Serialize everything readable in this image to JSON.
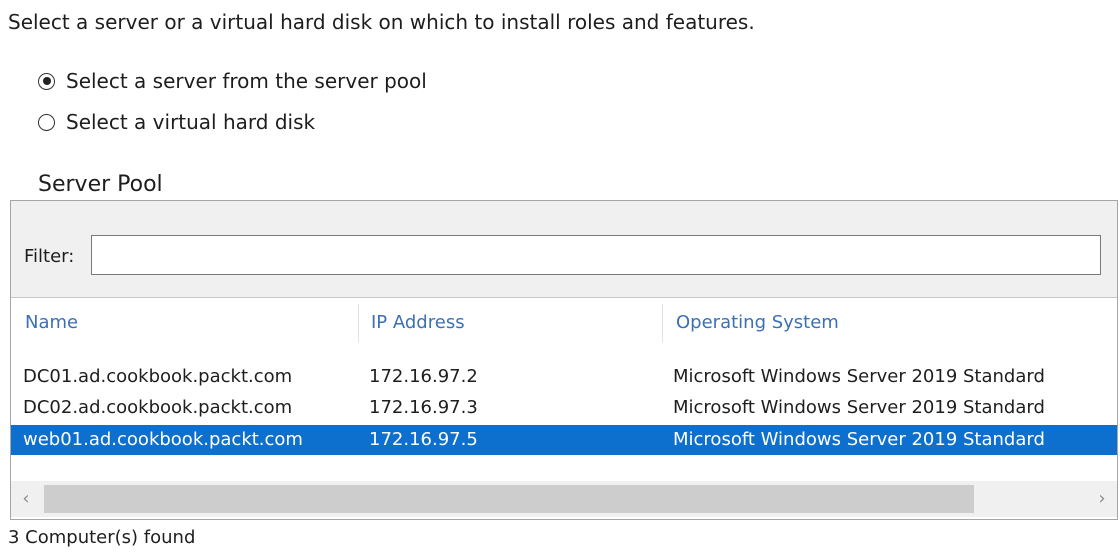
{
  "instruction": "Select a server or a virtual hard disk on which to install roles and features.",
  "options": [
    {
      "label": "Select a server from the server pool",
      "selected": true
    },
    {
      "label": "Select a virtual hard disk",
      "selected": false
    }
  ],
  "server_pool": {
    "title": "Server Pool",
    "filter_label": "Filter:",
    "filter_value": "",
    "columns": [
      "Name",
      "IP Address",
      "Operating System"
    ],
    "rows": [
      {
        "name": "DC01.ad.cookbook.packt.com",
        "ip": "172.16.97.2",
        "os": "Microsoft Windows Server 2019 Standard",
        "selected": false
      },
      {
        "name": "DC02.ad.cookbook.packt.com",
        "ip": "172.16.97.3",
        "os": "Microsoft Windows Server 2019 Standard",
        "selected": false
      },
      {
        "name": "web01.ad.cookbook.packt.com",
        "ip": "172.16.97.5",
        "os": "Microsoft Windows Server 2019 Standard",
        "selected": true
      }
    ],
    "scroll_left_icon": "‹",
    "scroll_right_icon": "›"
  },
  "status": "3 Computer(s) found",
  "colors": {
    "accent_header": "#3c70b4",
    "selection": "#0d6fce"
  }
}
